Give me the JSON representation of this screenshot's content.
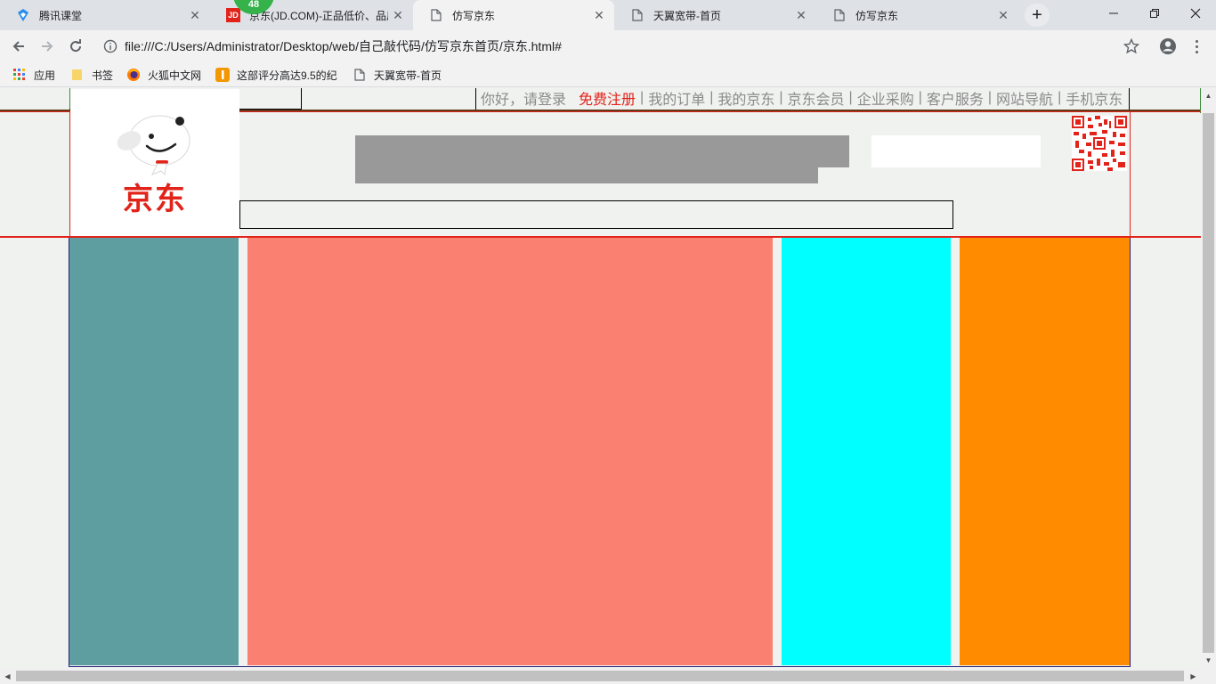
{
  "browser": {
    "tabs": [
      {
        "title": "腾讯课堂",
        "favicon": "tencent-classroom-icon",
        "active": false
      },
      {
        "title": "京东(JD.COM)-正品低价、品质保障、配送及时、轻松购物！",
        "favicon": "jd-icon",
        "active": false
      },
      {
        "title": "仿写京东",
        "favicon": "page-icon",
        "active": true
      },
      {
        "title": "天翼宽带-首页",
        "favicon": "page-icon",
        "active": false
      },
      {
        "title": "仿写京东",
        "favicon": "page-icon",
        "active": false
      }
    ],
    "badge_count": "48",
    "url": "file:///C:/Users/Administrator/Desktop/web/自己敲代码/仿写京东首页/京东.html#",
    "bookmarks": [
      {
        "label": "应用",
        "icon": "apps-grid-icon"
      },
      {
        "label": "书签",
        "icon": "folder-icon"
      },
      {
        "label": "火狐中文网",
        "icon": "firefox-icon"
      },
      {
        "label": "这部评分高达9.5的纪",
        "icon": "orange-app-icon"
      },
      {
        "label": "天翼宽带-首页",
        "icon": "page-icon"
      }
    ]
  },
  "page": {
    "shortcut": {
      "greeting": "你好，请登录",
      "register": "免费注册",
      "links": [
        "我的订单",
        "我的京东",
        "京东会员",
        "企业采购",
        "客户服务",
        "网站导航",
        "手机京东"
      ],
      "separator": "|"
    },
    "logo_text": "京东",
    "columns": [
      {
        "name": "left-category-column",
        "color": "#5f9ea0"
      },
      {
        "name": "center-banner-column",
        "color": "#fa8072"
      },
      {
        "name": "right-news-column",
        "color": "#00ffff"
      },
      {
        "name": "far-right-column",
        "color": "#ff8c00"
      }
    ],
    "colors": {
      "brand_red": "#e2231a",
      "search_gray": "#999999",
      "shortcut_text": "#8a8a8a"
    }
  }
}
